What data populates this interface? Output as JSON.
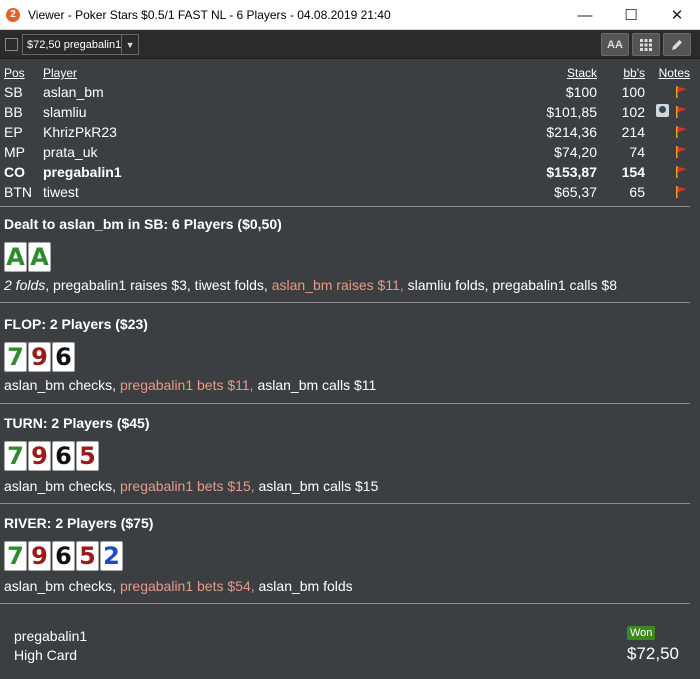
{
  "window": {
    "app_icon_label": "2",
    "title": "Viewer - Poker Stars $0.5/1 FAST NL - 6 Players - 04.08.2019 21:40",
    "minimize": "—",
    "maximize": "☐",
    "close": "✕"
  },
  "toolbar": {
    "player_select": "$72,50 pregabalin1",
    "font_button": "AA"
  },
  "table": {
    "headers": {
      "pos": "Pos",
      "player": "Player",
      "stack": "Stack",
      "bbs": "bb's",
      "notes": "Notes"
    },
    "rows": [
      {
        "pos": "SB",
        "player": "aslan_bm",
        "stack": "$100",
        "bbs": "100",
        "bold": false,
        "avatar": false
      },
      {
        "pos": "BB",
        "player": "slamliu",
        "stack": "$101,85",
        "bbs": "102",
        "bold": false,
        "avatar": true
      },
      {
        "pos": "EP",
        "player": "KhrizPkR23",
        "stack": "$214,36",
        "bbs": "214",
        "bold": false,
        "avatar": false
      },
      {
        "pos": "MP",
        "player": "prata_uk",
        "stack": "$74,20",
        "bbs": "74",
        "bold": false,
        "avatar": false
      },
      {
        "pos": "CO",
        "player": "pregabalin1",
        "stack": "$153,87",
        "bbs": "154",
        "bold": true,
        "avatar": false
      },
      {
        "pos": "BTN",
        "player": "tiwest",
        "stack": "$65,37",
        "bbs": "65",
        "bold": false,
        "avatar": false
      }
    ]
  },
  "preflop": {
    "title": "Dealt to aslan_bm in SB: 6 Players ($0,50)",
    "cards": [
      "A",
      "A"
    ],
    "actions": [
      {
        "text": "2 folds",
        "style": "it"
      },
      {
        "text": ", pregabalin1 raises $3, tiwest folds, ",
        "style": ""
      },
      {
        "text": "aslan_bm raises $11,",
        "style": "hl"
      },
      {
        "text": " slamliu folds, pregabalin1 calls $8",
        "style": ""
      }
    ]
  },
  "flop": {
    "title": "FLOP: 2 Players ($23)",
    "cards": [
      "7",
      "9",
      "6"
    ],
    "actions": [
      {
        "text": "aslan_bm checks, ",
        "style": ""
      },
      {
        "text": "pregabalin1 bets $11,",
        "style": "hl"
      },
      {
        "text": " aslan_bm calls $11",
        "style": ""
      }
    ]
  },
  "turn": {
    "title": "TURN: 2 Players ($45)",
    "cards": [
      "7",
      "9",
      "6",
      "5"
    ],
    "actions": [
      {
        "text": "aslan_bm checks, ",
        "style": ""
      },
      {
        "text": "pregabalin1 bets $15,",
        "style": "hl"
      },
      {
        "text": " aslan_bm calls $15",
        "style": ""
      }
    ]
  },
  "river": {
    "title": "RIVER: 2 Players ($75)",
    "cards": [
      "7",
      "9",
      "6",
      "5",
      "2"
    ],
    "actions": [
      {
        "text": "aslan_bm checks, ",
        "style": ""
      },
      {
        "text": "pregabalin1 bets $54,",
        "style": "hl"
      },
      {
        "text": " aslan_bm folds",
        "style": ""
      }
    ]
  },
  "result": {
    "winner": "pregabalin1",
    "hand": "High Card",
    "badge": "Won",
    "amount": "$72,50"
  },
  "colors": {
    "background": "#3c3f41",
    "highlight": "#e89a8a",
    "won": "#3b8a1f",
    "club_green": "#2e8b2e",
    "heart_red": "#9b1b1b",
    "spade_black": "#111111",
    "diamond_blue": "#1b4cc8"
  }
}
